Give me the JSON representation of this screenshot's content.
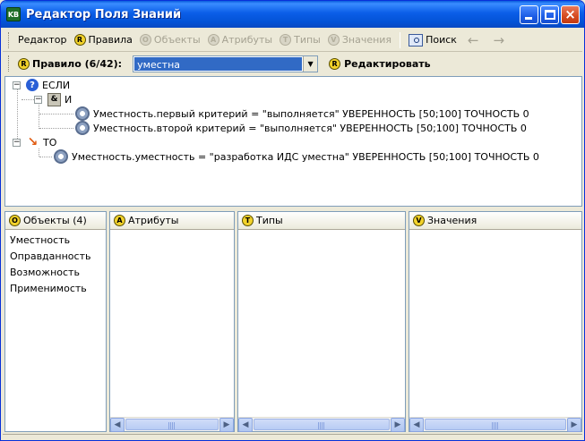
{
  "window": {
    "title": "Редактор Поля Знаний",
    "app_icon_text": "KB"
  },
  "toolbar1": {
    "editor_label": "Редактор",
    "rules_label": "Правила",
    "objects_label": "Объекты",
    "attributes_label": "Атрибуты",
    "types_label": "Типы",
    "values_label": "Значения",
    "search_label": "Поиск"
  },
  "toolbar2": {
    "rule_label": "Правило (6/42):",
    "combo_value": "уместна",
    "edit_label": "Редактировать"
  },
  "tree": {
    "if_label": "ЕСЛИ",
    "and_label": "И",
    "condition1": "Уместность.первый критерий = \"выполняется\" УВЕРЕННОСТЬ [50;100] ТОЧНОСТЬ 0",
    "condition2": "Уместность.второй критерий = \"выполняется\" УВЕРЕННОСТЬ [50;100] ТОЧНОСТЬ 0",
    "then_label": "ТО",
    "conclusion": "Уместность.уместность = \"разработка ИДС уместна\" УВЕРЕННОСТЬ [50;100] ТОЧНОСТЬ 0"
  },
  "panels": {
    "objects": {
      "title": "Объекты (4)",
      "items": [
        "Уместность",
        "Оправданность",
        "Возможность",
        "Применимость"
      ]
    },
    "attributes": {
      "title": "Атрибуты"
    },
    "types": {
      "title": "Типы"
    },
    "values": {
      "title": "Значения"
    }
  },
  "badges": {
    "rule": "R",
    "object": "O",
    "attribute": "A",
    "type": "T",
    "value": "V",
    "edit": "R"
  }
}
